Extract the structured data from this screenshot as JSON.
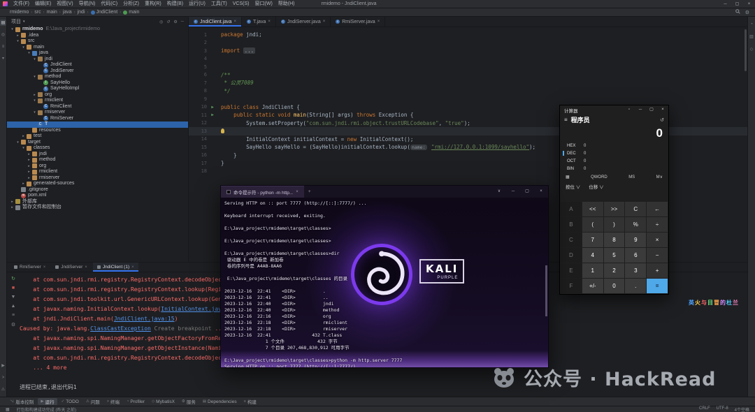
{
  "titlebar": {
    "title": "rmidemo - JndiClient.java",
    "menus": [
      "文件(F)",
      "编辑(E)",
      "视图(V)",
      "导航(N)",
      "代码(C)",
      "分析(Z)",
      "重构(R)",
      "构建(B)",
      "运行(U)",
      "工具(T)",
      "VCS(S)",
      "窗口(W)",
      "帮助(H)"
    ],
    "window_buttons": [
      {
        "glyph": "─",
        "name": "window-minimize-button"
      },
      {
        "glyph": "▢",
        "name": "window-maximize-button"
      },
      {
        "glyph": "×",
        "name": "window-close-button"
      }
    ]
  },
  "breadcrumbs": {
    "items": [
      {
        "label": "rmidemo"
      },
      {
        "label": "src"
      },
      {
        "label": "main"
      },
      {
        "label": "java"
      },
      {
        "label": "jndi"
      },
      {
        "label": "JndiClient",
        "icon": "class"
      },
      {
        "label": "main",
        "icon": "method"
      }
    ]
  },
  "left_stripe": [
    {
      "icon": "project",
      "active": true
    },
    {
      "icon": "commit"
    },
    {
      "icon": "structure"
    },
    {
      "icon": "bookmarks"
    }
  ],
  "left_stripe_bottom": [
    {
      "icon": "run"
    },
    {
      "icon": "terminal"
    },
    {
      "icon": "problems"
    }
  ],
  "right_stripe": [
    {
      "icon": "notifications"
    },
    {
      "icon": "database"
    },
    {
      "icon": "maven"
    }
  ],
  "project": {
    "header": "项目",
    "tree": [
      {
        "d": 0,
        "icon": "folder",
        "arrow": "v",
        "label": "rmidemo",
        "path": "E:\\Java_project\\rmidemo",
        "bold": true
      },
      {
        "d": 1,
        "icon": "folder",
        "arrow": ">",
        "label": ".idea"
      },
      {
        "d": 1,
        "icon": "folder",
        "arrow": "v",
        "label": "src"
      },
      {
        "d": 2,
        "icon": "folder",
        "arrow": "v",
        "label": "main"
      },
      {
        "d": 3,
        "icon": "srcroot",
        "arrow": "v",
        "label": "java"
      },
      {
        "d": 4,
        "icon": "pkg",
        "arrow": "v",
        "label": "jndi"
      },
      {
        "d": 5,
        "icon": "class",
        "arrow": "",
        "label": "JndiClient"
      },
      {
        "d": 5,
        "icon": "class",
        "arrow": "",
        "label": "JndiServer"
      },
      {
        "d": 4,
        "icon": "pkg",
        "arrow": "v",
        "label": "method"
      },
      {
        "d": 5,
        "icon": "iface",
        "arrow": "",
        "label": "SayHello"
      },
      {
        "d": 5,
        "icon": "class",
        "arrow": "",
        "label": "SayHelloImpl"
      },
      {
        "d": 4,
        "icon": "pkg",
        "arrow": ">",
        "label": "org"
      },
      {
        "d": 4,
        "icon": "pkg",
        "arrow": "v",
        "label": "rmiclient"
      },
      {
        "d": 5,
        "icon": "class",
        "arrow": "",
        "label": "RmiClient"
      },
      {
        "d": 4,
        "icon": "pkg",
        "arrow": "v",
        "label": "rmiserver"
      },
      {
        "d": 5,
        "icon": "class",
        "arrow": "",
        "label": "RmiServer"
      },
      {
        "d": 4,
        "icon": "class",
        "arrow": "",
        "label": "T",
        "selected": true
      },
      {
        "d": 3,
        "icon": "folder",
        "arrow": "",
        "label": "resources"
      },
      {
        "d": 2,
        "icon": "folder",
        "arrow": ">",
        "label": "test"
      },
      {
        "d": 1,
        "icon": "folder",
        "arrow": "v",
        "label": "target"
      },
      {
        "d": 2,
        "icon": "folder",
        "arrow": "v",
        "label": "classes"
      },
      {
        "d": 3,
        "icon": "folder",
        "arrow": ">",
        "label": "jndi"
      },
      {
        "d": 3,
        "icon": "folder",
        "arrow": ">",
        "label": "method"
      },
      {
        "d": 3,
        "icon": "folder",
        "arrow": ">",
        "label": "org"
      },
      {
        "d": 3,
        "icon": "folder",
        "arrow": ">",
        "label": "rmiclient"
      },
      {
        "d": 3,
        "icon": "folder",
        "arrow": ">",
        "label": "rmiserver"
      },
      {
        "d": 2,
        "icon": "folder",
        "arrow": ">",
        "label": "generated-sources"
      },
      {
        "d": 1,
        "icon": "file",
        "arrow": "",
        "label": ".gitignore"
      },
      {
        "d": 1,
        "icon": "maven",
        "arrow": "",
        "label": "pom.xml"
      },
      {
        "d": 0,
        "icon": "lib",
        "arrow": ">",
        "label": "外部库"
      },
      {
        "d": 0,
        "icon": "console",
        "arrow": ">",
        "label": "暂存文件和控制台"
      }
    ]
  },
  "editor": {
    "tabs": [
      {
        "label": "JndiClient.java",
        "active": true
      },
      {
        "label": "T.java"
      },
      {
        "label": "JndiServer.java"
      },
      {
        "label": "RmiServer.java"
      }
    ],
    "lines": [
      {
        "n": 1,
        "segs": [
          [
            "k",
            "package "
          ],
          [
            "d",
            "jndi;"
          ]
        ]
      },
      {
        "n": 2,
        "segs": []
      },
      {
        "n": 3,
        "segs": [
          [
            "k",
            "import "
          ],
          [
            "fold",
            "..."
          ]
        ]
      },
      {
        "n": 4,
        "segs": []
      },
      {
        "n": 5,
        "segs": []
      },
      {
        "n": 6,
        "segs": [
          [
            "c",
            "/**"
          ]
        ]
      },
      {
        "n": 7,
        "segs": [
          [
            "c",
            " * 公灵7089"
          ]
        ]
      },
      {
        "n": 8,
        "segs": [
          [
            "c",
            " */"
          ]
        ]
      },
      {
        "n": 9,
        "segs": []
      },
      {
        "n": 10,
        "segs": [
          [
            "k",
            "public class "
          ],
          [
            "d",
            "JndiClient {"
          ]
        ],
        "run": true
      },
      {
        "n": 11,
        "segs": [
          [
            "d",
            "    "
          ],
          [
            "k",
            "public static void "
          ],
          [
            "m",
            "main"
          ],
          [
            "d",
            "(String[] args) "
          ],
          [
            "k",
            "throws "
          ],
          [
            "d",
            "Exception {"
          ]
        ],
        "run": true
      },
      {
        "n": 12,
        "segs": [
          [
            "d",
            "        System.setProperty("
          ],
          [
            "s",
            "\"com.sun.jndi.rmi.object.trustURLCodebase\""
          ],
          [
            "d",
            ", "
          ],
          [
            "s",
            "\"true\""
          ],
          [
            "d",
            ");"
          ]
        ]
      },
      {
        "n": 13,
        "segs": [],
        "current": true,
        "bulb": true
      },
      {
        "n": 14,
        "segs": [
          [
            "d",
            "        InitialContext initialContext = "
          ],
          [
            "k",
            "new "
          ],
          [
            "d",
            "InitialContext();"
          ]
        ]
      },
      {
        "n": 15,
        "segs": [
          [
            "d",
            "        SayHello sayHello = (SayHello)initialContext.lookup("
          ],
          [
            "hint",
            "name:"
          ],
          [
            "d",
            " "
          ],
          [
            "surl",
            "\"rmi://127.0.0.1:1099/sayhello\""
          ],
          [
            "d",
            ");"
          ]
        ]
      },
      {
        "n": 16,
        "segs": [
          [
            "d",
            "    }"
          ]
        ]
      },
      {
        "n": 17,
        "segs": [
          [
            "d",
            "}"
          ]
        ]
      },
      {
        "n": 18,
        "segs": []
      }
    ]
  },
  "terminal": {
    "tab_title": "命令提示符 - python  -m http...",
    "lines": [
      "Serving HTTP on :: port 7777 (http://[::]:7777/) ...",
      "",
      "Keyboard interrupt received, exiting.",
      "",
      "E:\\Java_project\\rmidemo\\target\\classes>",
      "",
      "E:\\Java_project\\rmidemo\\target\\classes>",
      "",
      "E:\\Java_project\\rmidemo\\target\\classes>dir",
      " 驱动器 E 中的卷是 新加卷",
      " 卷的序列号是 A4AB-8AA6",
      "",
      " E:\\Java_project\\rmidemo\\target\\classes 的目录",
      "",
      "2023-12-16  22:41    <DIR>          .",
      "2023-12-16  22:41    <DIR>          ..",
      "2023-12-16  22:40    <DIR>          jndi",
      "2023-12-16  22:40    <DIR>          method",
      "2023-12-16  22:16    <DIR>          org",
      "2023-12-16  22:18    <DIR>          rmiclient",
      "2023-12-16  22:18    <DIR>          rmiserver",
      "2023-12-16  22:41               432 T.class",
      "               1 个文件            432 字节",
      "               7 个目录 207,468,830,912 可用字节",
      "",
      "E:\\Java_project\\rmidemo\\target\\classes>python -m http.server 7777",
      "Serving HTTP on :: port 7777 (http://[::]:7777/) ..."
    ],
    "logo": {
      "main": "KALI",
      "sub": "PURPLE"
    }
  },
  "calculator": {
    "title": "计算器",
    "mode": "程序员",
    "display": "0",
    "radix": [
      {
        "label": "HEX",
        "value": "0"
      },
      {
        "label": "DEC",
        "value": "0",
        "active": true
      },
      {
        "label": "OCT",
        "value": "0"
      },
      {
        "label": "BIN",
        "value": "0"
      }
    ],
    "word_size": "QWORD",
    "memory_store": "MS",
    "memory_menu": "M∨",
    "bitwise": "按位 ∨",
    "shift": "位移 ∨",
    "keys": [
      [
        "A",
        "<<",
        ">>",
        "C",
        "←"
      ],
      [
        "B",
        "(",
        ")",
        "%",
        "÷"
      ],
      [
        "C",
        "7",
        "8",
        "9",
        "×"
      ],
      [
        "D",
        "4",
        "5",
        "6",
        "−"
      ],
      [
        "E",
        "1",
        "2",
        "3",
        "+"
      ],
      [
        "F",
        "+/-",
        "0",
        ".",
        "="
      ]
    ]
  },
  "console": {
    "tabs": [
      {
        "label": "RmiServer"
      },
      {
        "label": "JndiServer"
      },
      {
        "label": "JndiClient (1)",
        "active": true
      }
    ],
    "lines": [
      [
        [
          "err",
          "    at com.sun.jndi.rmi.registry.RegistryContext.decodeObject(RegistryContext"
        ]
      ],
      [
        [
          "err",
          "    at com.sun.jndi.rmi.registry.RegistryContext.lookup(RegistryContext.java"
        ]
      ],
      [
        [
          "err",
          "    at com.sun.jndi.toolkit.url.GenericURLContext.lookup(GenericURLContext"
        ]
      ],
      [
        [
          "err",
          "    at javax.naming.InitialContext.lookup("
        ],
        [
          "link",
          "InitialContext.java:417"
        ],
        [
          "err",
          ")"
        ]
      ],
      [
        [
          "err",
          "    at jndi.JndiClient.main("
        ],
        [
          "link",
          "JndiClient.java:15"
        ],
        [
          "err",
          ")"
        ]
      ],
      [
        [
          "err",
          "Caused by: java.lang."
        ],
        [
          "link",
          "ClassCastException"
        ],
        [
          "hint",
          " Create breakpoint "
        ],
        [
          "err",
          "..."
        ]
      ],
      [
        [
          "err",
          "    at javax.naming.spi.NamingManager.getObjectFactoryFromReference(NamingMan"
        ]
      ],
      [
        [
          "err",
          "    at javax.naming.spi.NamingManager.getObjectInstance(NamingManager.java"
        ]
      ],
      [
        [
          "err",
          "    at com.sun.jndi.rmi.registry.RegistryContext.decodeObject(RegistryContext"
        ]
      ],
      [
        [
          "err",
          "    ... 4 more"
        ]
      ]
    ],
    "exit_text": "进程已结束,退出代码1"
  },
  "bottombar": {
    "items": [
      {
        "label": "版本控制",
        "icon": "vcs"
      },
      {
        "label": "运行",
        "icon": "run",
        "active": true
      },
      {
        "label": "TODO",
        "icon": "todo"
      },
      {
        "label": "问题",
        "icon": "problems"
      },
      {
        "label": "终端",
        "icon": "terminal"
      },
      {
        "label": "Profiler",
        "icon": "profiler"
      },
      {
        "label": "MybatisX",
        "icon": "plugin"
      },
      {
        "label": "服务",
        "icon": "services"
      },
      {
        "label": "Dependencies",
        "icon": "deps"
      },
      {
        "label": "构建",
        "icon": "build"
      }
    ]
  },
  "statusbar": {
    "left": "打包和构建成功完成 (昨天 之前)",
    "right": [
      "CRLF",
      "UTF-8",
      "4个空格"
    ]
  },
  "watermark": {
    "text": "公众号 · HackRead"
  },
  "mini_watermark": [
    {
      "t": "英",
      "c": "#4da3ff"
    },
    {
      "t": "火",
      "c": "#ffd24d"
    },
    {
      "t": "与",
      "c": "#ff6b6b"
    },
    {
      "t": "目",
      "c": "#6bdc7f"
    },
    {
      "t": "冒",
      "c": "#ffa94d"
    },
    {
      "t": "的",
      "c": "#d08bff"
    },
    {
      "t": "杜",
      "c": "#4dd2ff"
    },
    {
      "t": "兰",
      "c": "#ff8bd0"
    }
  ]
}
